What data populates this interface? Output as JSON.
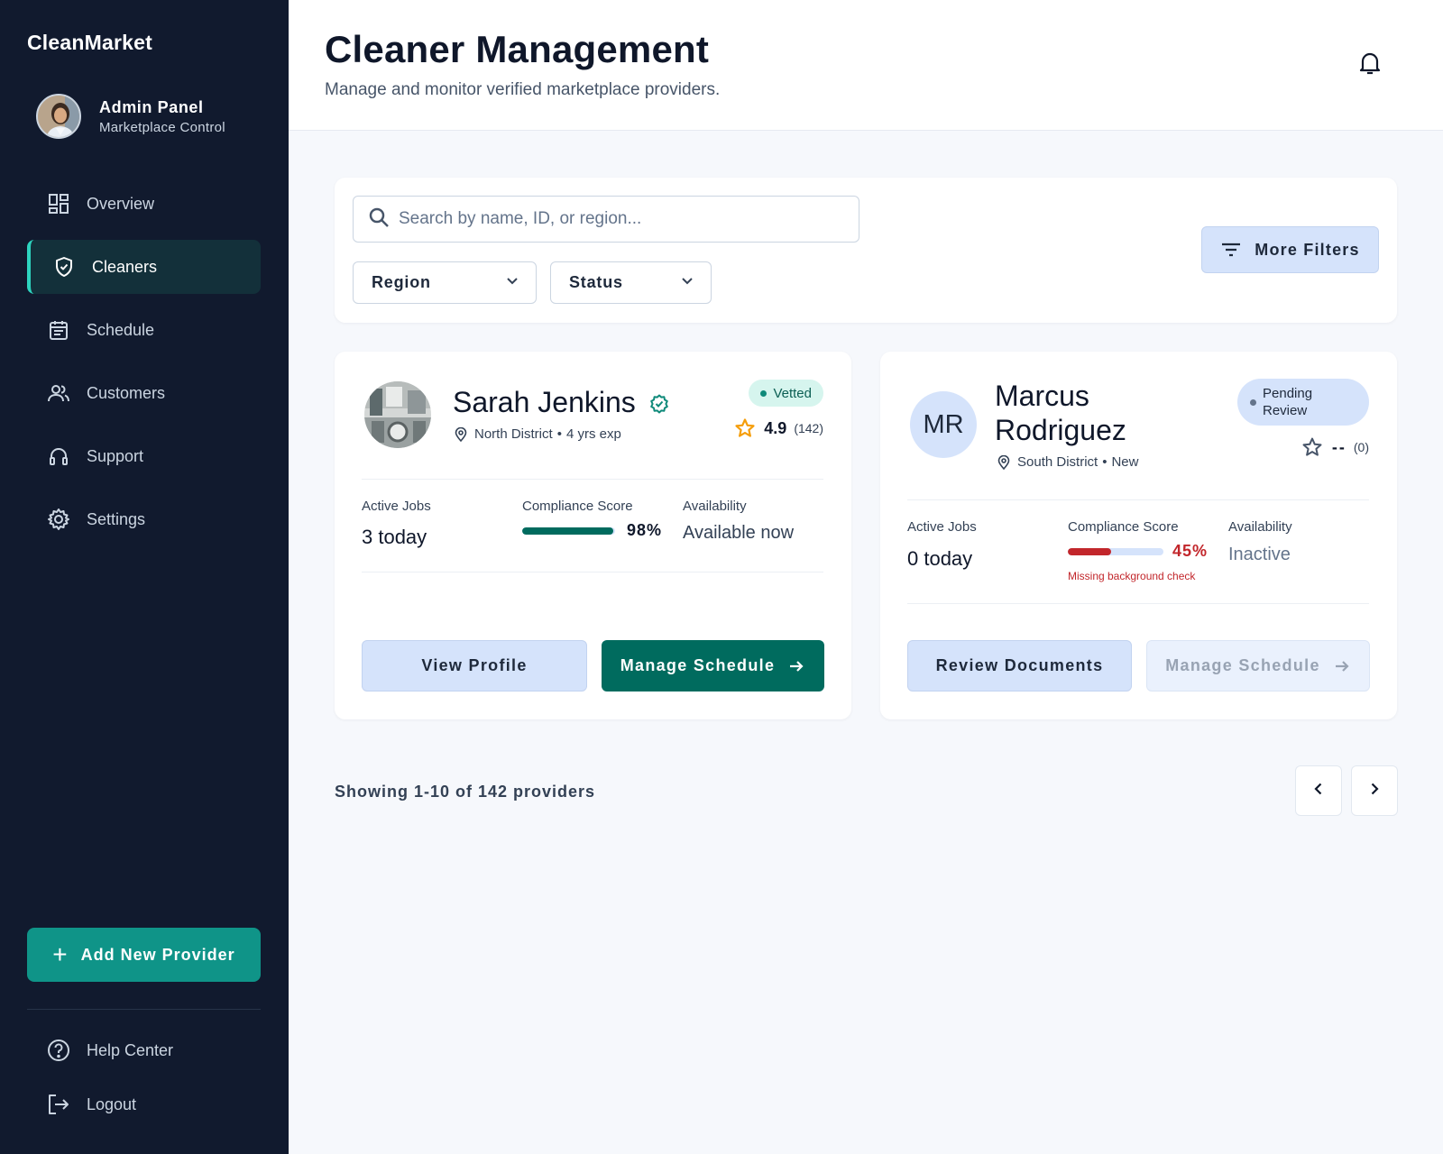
{
  "app": {
    "brand": "CleanMarket"
  },
  "profile": {
    "name": "Admin Panel",
    "subtitle": "Marketplace Control"
  },
  "nav": [
    {
      "label": "Overview",
      "icon": "dashboard-icon",
      "active": false
    },
    {
      "label": "Cleaners",
      "icon": "shield-check-icon",
      "active": true
    },
    {
      "label": "Schedule",
      "icon": "calendar-icon",
      "active": false
    },
    {
      "label": "Customers",
      "icon": "users-icon",
      "active": false
    },
    {
      "label": "Support",
      "icon": "headset-icon",
      "active": false
    },
    {
      "label": "Settings",
      "icon": "gear-icon",
      "active": false
    }
  ],
  "sidebar_actions": {
    "add_provider": "Add New Provider"
  },
  "footer_nav": {
    "help": "Help Center",
    "logout": "Logout"
  },
  "header": {
    "title": "Cleaner Management",
    "subtitle": "Manage and monitor verified marketplace providers."
  },
  "filters": {
    "search_placeholder": "Search by name, ID, or region...",
    "region": "Region",
    "status": "Status",
    "more": "More Filters"
  },
  "cards": [
    {
      "name": "Sarah Jenkins",
      "location": "North District",
      "meta": "4 yrs exp",
      "badge": "Vetted",
      "rating": "4.9",
      "rating_count": "(142)",
      "active_jobs_label": "Active Jobs",
      "active_jobs": "3 today",
      "compliance_label": "Compliance Score",
      "compliance_pct": "98%",
      "compliance_fraction": 0.98,
      "availability_label": "Availability",
      "availability": "Available now",
      "primary_action": "View Profile",
      "secondary_action": "Manage Schedule"
    },
    {
      "initials": "MR",
      "name_line1": "Marcus",
      "name_line2": "Rodriguez",
      "location": "South District",
      "meta": "New",
      "badge_line1": "Pending",
      "badge_line2": "Review",
      "rating": "--",
      "rating_count": "(0)",
      "active_jobs_label": "Active Jobs",
      "active_jobs": "0 today",
      "compliance_label": "Compliance Score",
      "compliance_pct": "45%",
      "compliance_fraction": 0.45,
      "compliance_warning": "Missing background check",
      "availability_label": "Availability",
      "availability": "Inactive",
      "primary_action": "Review Documents",
      "secondary_action": "Manage Schedule"
    }
  ],
  "pagination": {
    "showing": "Showing 1-10 of 142 providers"
  },
  "colors": {
    "sidebar_bg": "#111a2e",
    "accent_teal": "#0f9488",
    "primary_dark": "#006b5e",
    "light_blue": "#d5e3fb",
    "danger": "#c2262b",
    "star": "#f59e0b"
  }
}
